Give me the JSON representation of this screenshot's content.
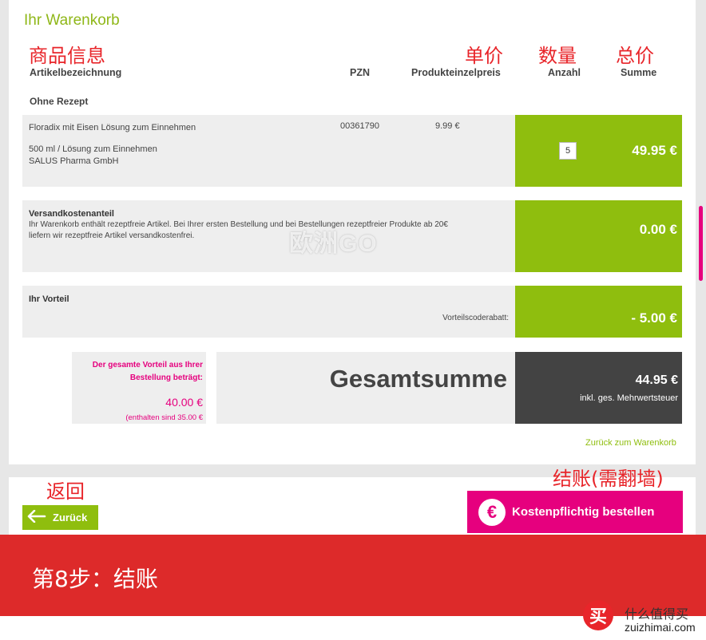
{
  "page": {
    "title": "Ihr Warenkorb"
  },
  "annotations": {
    "product_info": "商品信息",
    "unit_price": "单价",
    "quantity": "数量",
    "total_price": "总价",
    "back": "返回",
    "checkout": "结账(需翻墙)"
  },
  "columns": {
    "article": "Artikelbezeichnung",
    "pzn": "PZN",
    "unit_price": "Produkteinzelpreis",
    "quantity": "Anzahl",
    "sum": "Summe"
  },
  "section": {
    "label": "Ohne Rezept"
  },
  "product": {
    "name": "Floradix mit Eisen Lösung zum Einnehmen",
    "pzn": "00361790",
    "unit_price": "9.99 €",
    "detail": "500 ml / Lösung zum Einnehmen",
    "manufacturer": "SALUS Pharma GmbH",
    "quantity": "5",
    "sum": "49.95 €"
  },
  "shipping": {
    "title": "Versandkostenanteil",
    "line1": "Ihr Warenkorb enthält rezeptfreie Artikel. Bei Ihrer ersten Bestellung und bei Bestellungen rezeptfreier Produkte ab 20€",
    "line2": "liefern wir rezeptfreie Artikel versandkostenfrei.",
    "amount": "0.00 €"
  },
  "advantage": {
    "title": "Ihr Vorteil",
    "label": "Vorteilscoderabatt:",
    "amount": "- 5.00 €"
  },
  "savings": {
    "text_line1": "Der gesamte Vorteil aus Ihrer",
    "text_line2": "Bestellung beträgt:",
    "amount": "40.00 €",
    "note": "(enthalten sind 35.00 €"
  },
  "total": {
    "label": "Gesamtsumme",
    "amount": "44.95 €",
    "tax_note": "inkl. ges. Mehrwertsteuer"
  },
  "links": {
    "back_to_cart": "Zurück zum Warenkorb"
  },
  "buttons": {
    "back": "Zurück",
    "order": "Kostenpflichtig bestellen",
    "order_icon": "€"
  },
  "banner": {
    "text": "第8步：结账"
  },
  "watermark": {
    "text": "欧洲GO"
  },
  "brand": {
    "logo_char": "买",
    "name": "什么值得买",
    "url": "zuizhimai.com"
  },
  "colors": {
    "green": "#8fbe0e",
    "title_green": "#8fb718",
    "magenta": "#e6007e",
    "dark": "#434343",
    "banner_red": "#dd2a2a",
    "annotation_red": "#e8252a"
  }
}
